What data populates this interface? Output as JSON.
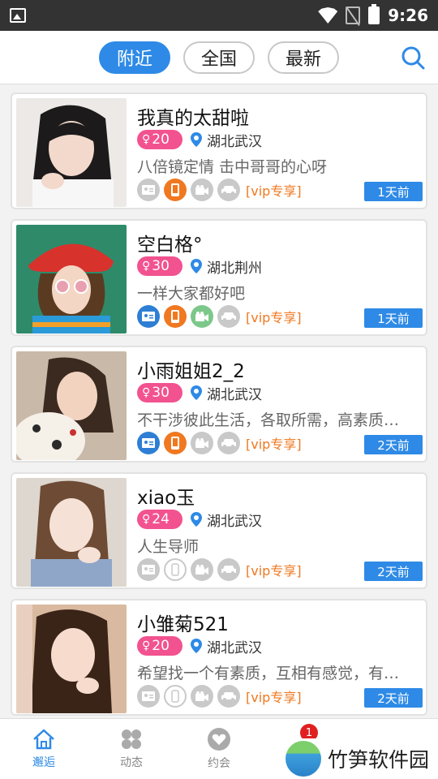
{
  "status_bar": {
    "time": "9:26",
    "icons": [
      "gallery-icon",
      "wifi-icon",
      "no-sim-icon",
      "battery-charging-icon"
    ]
  },
  "tabs": [
    {
      "label": "附近",
      "active": true
    },
    {
      "label": "全国",
      "active": false
    },
    {
      "label": "最新",
      "active": false
    }
  ],
  "colors": {
    "accent": "#2e8ae6",
    "age_badge": "#f2528f",
    "vip": "#f07820",
    "phone_on": "#f07820",
    "id_on": "#2e7fd4",
    "video_on": "#7cc88a"
  },
  "cards": [
    {
      "name": "我真的太甜啦",
      "age": "20",
      "location": "湖北武汉",
      "bio": "八倍镜定情  击中哥哥的心呀",
      "icons": {
        "id": "off",
        "phone": "on",
        "video": "off",
        "car": "off"
      },
      "vip": "[vip专享]",
      "time": "1天前"
    },
    {
      "name": "空白格°",
      "age": "30",
      "location": "湖北荆州",
      "bio": "一样大家都好吧",
      "icons": {
        "id": "on",
        "phone": "on",
        "video": "on",
        "car": "off"
      },
      "vip": "[vip专享]",
      "time": "1天前"
    },
    {
      "name": "小雨姐姐2_2",
      "age": "30",
      "location": "湖北武汉",
      "bio": "不干涉彼此生活，各取所需，高素质大…",
      "icons": {
        "id": "on",
        "phone": "on",
        "video": "off",
        "car": "off"
      },
      "vip": "[vip专享]",
      "time": "2天前"
    },
    {
      "name": "xiao玉",
      "age": "24",
      "location": "湖北武汉",
      "bio": "人生导师",
      "icons": {
        "id": "off",
        "phone": "outline",
        "video": "off",
        "car": "off"
      },
      "vip": "[vip专享]",
      "time": "2天前"
    },
    {
      "name": "小雏菊521",
      "age": "20",
      "location": "湖北武汉",
      "bio": "希望找一个有素质，互相有感觉，有经…",
      "icons": {
        "id": "off",
        "phone": "outline",
        "video": "off",
        "car": "off"
      },
      "vip": "[vip专享]",
      "time": "2天前"
    }
  ],
  "bottom_nav": [
    {
      "label": "邂逅",
      "icon": "home-icon",
      "active": true
    },
    {
      "label": "动态",
      "icon": "grid-icon",
      "active": false
    },
    {
      "label": "约会",
      "icon": "heart-icon",
      "active": false
    },
    {
      "label": "",
      "icon": "message-icon",
      "active": false,
      "badge": "1"
    },
    {
      "label": "",
      "icon": "profile-icon",
      "active": false
    }
  ],
  "watermark": {
    "text": "竹笋软件园"
  }
}
